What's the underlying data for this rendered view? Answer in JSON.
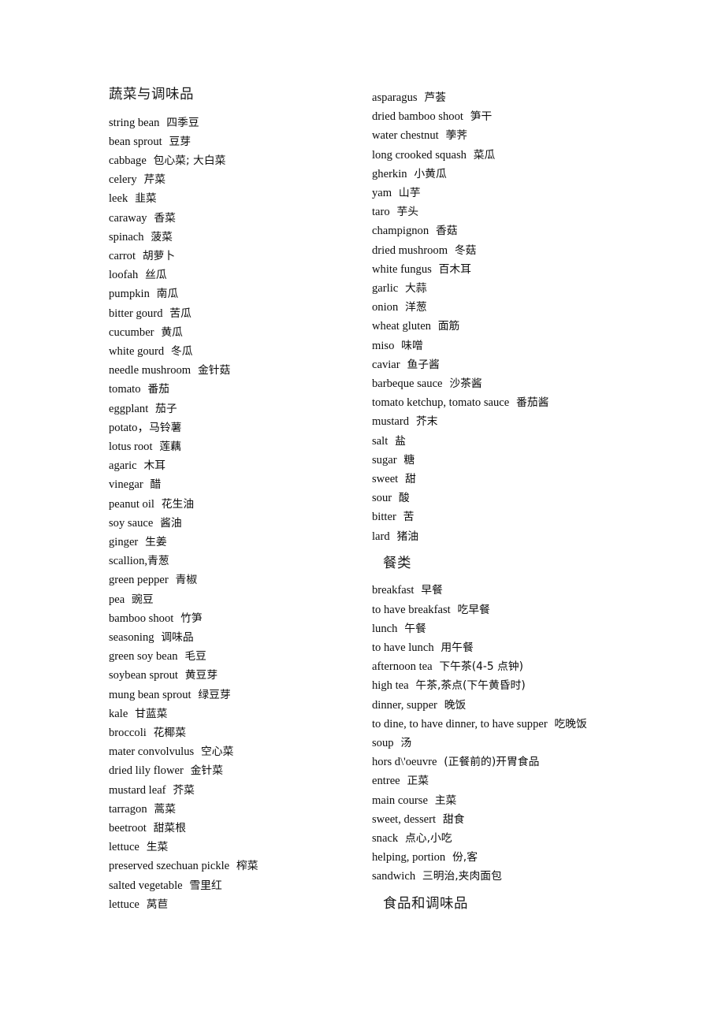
{
  "document": {
    "background_color": "#ffffff",
    "text_color": "#000000"
  },
  "columns": {
    "left": {
      "heading": "蔬菜与调味品",
      "entries": [
        {
          "term": "string bean",
          "gloss": "四季豆"
        },
        {
          "term": "bean sprout",
          "gloss": "豆芽"
        },
        {
          "term": "cabbage",
          "gloss": "包心菜; 大白菜"
        },
        {
          "term": "celery",
          "gloss": "芹菜"
        },
        {
          "term": "leek",
          "gloss": "韭菜"
        },
        {
          "term": "caraway",
          "gloss": "香菜"
        },
        {
          "term": "spinach",
          "gloss": "菠菜"
        },
        {
          "term": "carrot",
          "gloss": "胡萝卜"
        },
        {
          "term": "loofah",
          "gloss": "丝瓜"
        },
        {
          "term": "pumpkin",
          "gloss": "南瓜"
        },
        {
          "term": "bitter gourd",
          "gloss": "苦瓜"
        },
        {
          "term": "cucumber",
          "gloss": "黄瓜"
        },
        {
          "term": "white gourd",
          "gloss": "冬瓜"
        },
        {
          "term": "needle mushroom",
          "gloss": "金针菇"
        },
        {
          "term": "tomato",
          "gloss": "番茄"
        },
        {
          "term": "eggplant",
          "gloss": "茄子"
        },
        {
          "term": "potato，",
          "gloss": "马铃薯",
          "tight": true
        },
        {
          "term": "lotus root",
          "gloss": "莲藕"
        },
        {
          "term": "agaric",
          "gloss": "木耳"
        },
        {
          "term": "vinegar",
          "gloss": "醋"
        },
        {
          "term": "peanut oil",
          "gloss": "花生油"
        },
        {
          "term": "soy sauce",
          "gloss": "酱油"
        },
        {
          "term": "ginger",
          "gloss": "生姜"
        },
        {
          "term": "scallion,",
          "gloss": "青葱",
          "tight": true
        },
        {
          "term": "green pepper",
          "gloss": "青椒"
        },
        {
          "term": "pea",
          "gloss": "豌豆"
        },
        {
          "term": "bamboo shoot",
          "gloss": "竹笋"
        },
        {
          "term": "seasoning",
          "gloss": "调味品"
        },
        {
          "term": "green soy bean",
          "gloss": "毛豆"
        },
        {
          "term": "soybean sprout",
          "gloss": "黄豆芽"
        },
        {
          "term": "mung bean sprout",
          "gloss": "绿豆芽"
        },
        {
          "term": "kale",
          "gloss": "甘蓝菜"
        },
        {
          "term": "broccoli",
          "gloss": "花椰菜"
        },
        {
          "term": "mater convolvulus",
          "gloss": "空心菜"
        },
        {
          "term": "dried lily flower",
          "gloss": "金针菜"
        },
        {
          "term": "mustard leaf",
          "gloss": "芥菜"
        },
        {
          "term": "tarragon",
          "gloss": "蒿菜"
        },
        {
          "term": "beetroot",
          "gloss": "甜菜根"
        },
        {
          "term": "lettuce",
          "gloss": "生菜"
        },
        {
          "term": "preserved szechuan pickle",
          "gloss": "榨菜"
        },
        {
          "term": "salted vegetable",
          "gloss": "雪里红"
        },
        {
          "term": "lettuce",
          "gloss": "莴苣"
        }
      ]
    },
    "right": {
      "entries_top": [
        {
          "term": "asparagus",
          "gloss": "芦荟"
        },
        {
          "term": "dried bamboo shoot",
          "gloss": "笋干"
        },
        {
          "term": "water chestnut",
          "gloss": "荸荠"
        },
        {
          "term": "long crooked squash",
          "gloss": "菜瓜"
        },
        {
          "term": "gherkin",
          "gloss": "小黄瓜"
        },
        {
          "term": "yam",
          "gloss": "山芋"
        },
        {
          "term": "taro",
          "gloss": "芋头"
        },
        {
          "term": "champignon",
          "gloss": "香菇"
        },
        {
          "term": "dried mushroom",
          "gloss": "冬菇"
        },
        {
          "term": "white fungus",
          "gloss": "百木耳"
        },
        {
          "term": "garlic",
          "gloss": "大蒜"
        },
        {
          "term": "onion",
          "gloss": "洋葱"
        },
        {
          "term": "wheat gluten",
          "gloss": "面筋"
        },
        {
          "term": "miso",
          "gloss": "味噌"
        },
        {
          "term": "caviar",
          "gloss": "鱼子酱"
        },
        {
          "term": "barbeque sauce",
          "gloss": "沙茶酱"
        },
        {
          "term": "tomato ketchup, tomato sauce",
          "gloss": "番茄酱"
        },
        {
          "term": "mustard",
          "gloss": "芥末"
        },
        {
          "term": "salt",
          "gloss": "盐"
        },
        {
          "term": "sugar",
          "gloss": "糖"
        },
        {
          "term": "sweet",
          "gloss": "甜"
        },
        {
          "term": "sour",
          "gloss": "酸"
        },
        {
          "term": "bitter",
          "gloss": "苦"
        },
        {
          "term": "lard",
          "gloss": "猪油"
        }
      ],
      "heading_meals": "餐类",
      "entries_meals": [
        {
          "term": "breakfast",
          "gloss": "早餐"
        },
        {
          "term": "to have breakfast",
          "gloss": "吃早餐"
        },
        {
          "term": "lunch",
          "gloss": "午餐"
        },
        {
          "term": "to have lunch",
          "gloss": "用午餐"
        },
        {
          "term": "afternoon tea",
          "gloss": "下午茶(4-5 点钟)"
        },
        {
          "term": "high tea",
          "gloss": "午茶,茶点(下午黄昏时)"
        },
        {
          "term": "dinner, supper",
          "gloss": "晚饭"
        },
        {
          "term": "to dine, to have dinner, to have supper",
          "gloss": "吃晚饭"
        },
        {
          "term": "soup",
          "gloss": "汤"
        },
        {
          "term": "hors d\\'oeuvre",
          "gloss": "(正餐前的)开胃食品"
        },
        {
          "term": "entree",
          "gloss": "正菜"
        },
        {
          "term": "main course",
          "gloss": "主菜"
        },
        {
          "term": "sweet, dessert",
          "gloss": "甜食"
        },
        {
          "term": "snack",
          "gloss": "点心,小吃"
        },
        {
          "term": "helping, portion",
          "gloss": "份,客"
        },
        {
          "term": "sandwich",
          "gloss": "三明治,夹肉面包"
        }
      ],
      "heading_foods": "食品和调味品"
    }
  }
}
